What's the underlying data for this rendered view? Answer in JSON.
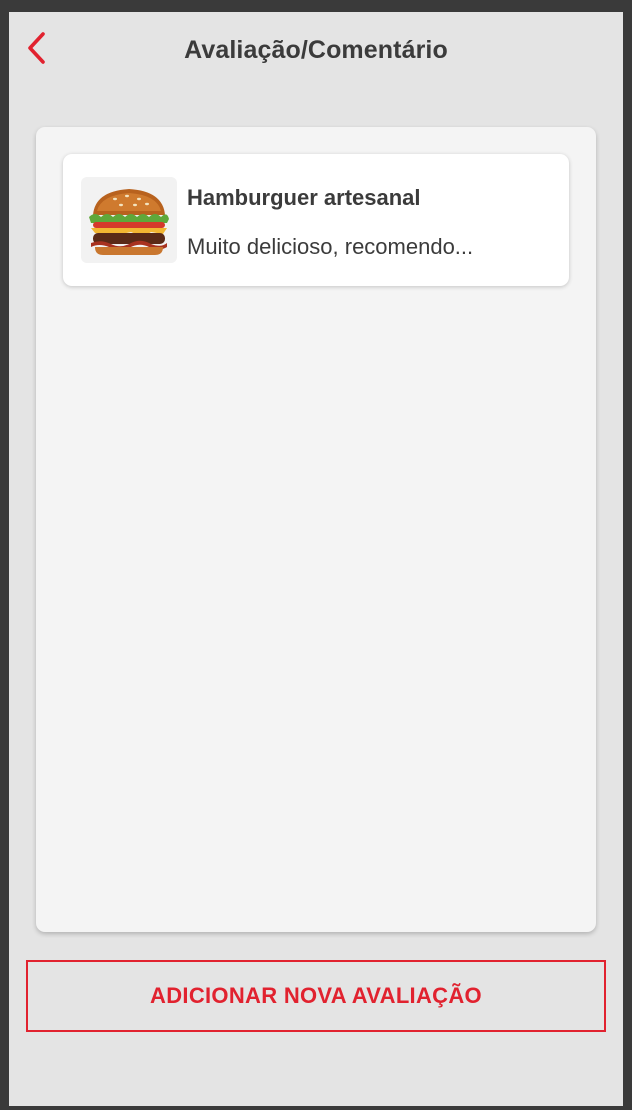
{
  "header": {
    "title": "Avaliação/Comentário",
    "back_icon": "chevron-left-icon"
  },
  "reviews": [
    {
      "image": "hamburger-image",
      "title": "Hamburguer artesanal",
      "comment": "Muito delicioso, recomendo..."
    }
  ],
  "actions": {
    "add_review_label": "ADICIONAR NOVA AVALIAÇÃO"
  },
  "colors": {
    "accent": "#e1222f",
    "background": "#e4e4e4",
    "panel": "#f4f4f4",
    "card": "#ffffff",
    "text": "#3b3b3b"
  }
}
